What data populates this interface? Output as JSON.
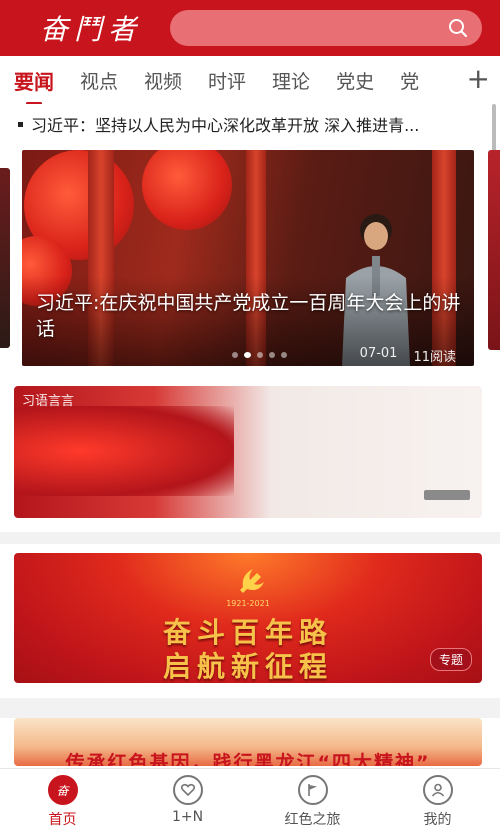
{
  "header": {
    "logo_text": "奋鬥者",
    "brand_color": "#c8141c",
    "search_icon": "search-icon"
  },
  "tabs": [
    {
      "label": "要闻",
      "active": true
    },
    {
      "label": "视点",
      "active": false
    },
    {
      "label": "视频",
      "active": false
    },
    {
      "label": "时评",
      "active": false
    },
    {
      "label": "理论",
      "active": false
    },
    {
      "label": "党史",
      "active": false
    },
    {
      "label": "党",
      "active": false
    }
  ],
  "tabs_more_icon": "plus-icon",
  "ticker": {
    "text": "习近平：坚持以人民为中心深化改革开放 深入推进青..."
  },
  "carousel": {
    "caption": "习近平:在庆祝中国共产党成立一百周年大会上的讲话",
    "date": "07-01",
    "reads": "11阅读",
    "slide_count": 5,
    "active_index": 1
  },
  "banners": {
    "banner1_label": "习语言言",
    "banner2_years": "1921-2021",
    "banner2_line1": "奋斗百年路",
    "banner2_line2": "启航新征程",
    "banner2_badge": "专题",
    "banner3_text": "传承红色基因，践行黑龙江“四大精神”"
  },
  "bottom_nav": [
    {
      "label": "首页",
      "icon": "home-logo-icon",
      "active": true
    },
    {
      "label": "1+N",
      "icon": "heart-chat-icon",
      "active": false
    },
    {
      "label": "红色之旅",
      "icon": "flag-chat-icon",
      "active": false
    },
    {
      "label": "我的",
      "icon": "user-icon",
      "active": false
    }
  ]
}
